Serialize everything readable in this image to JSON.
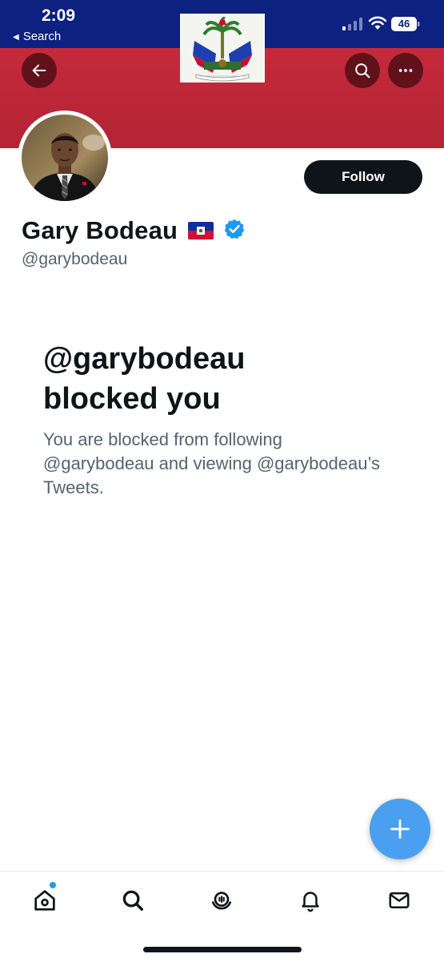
{
  "status_bar": {
    "time": "2:09",
    "back_app": "Search",
    "battery": "46"
  },
  "header": {
    "back_icon": "arrow-left-icon",
    "search_icon": "search-icon",
    "more_icon": "more-horizontal-icon",
    "banner_colors": {
      "top": "#0d2180",
      "bottom": "#c52a3b"
    }
  },
  "profile": {
    "display_name": "Gary Bodeau",
    "handle": "@garybodeau",
    "follow_label": "Follow",
    "flag_emoji": "🇭🇹",
    "verified": true
  },
  "blocked": {
    "title_line1": "@garybodeau",
    "title_line2": "blocked you",
    "description": "You are blocked from following @garybodeau and viewing @garybodeau’s Tweets."
  },
  "fab": {
    "icon": "plus-icon"
  },
  "tabbar": {
    "items": [
      {
        "icon": "home-icon",
        "has_notification_dot": true
      },
      {
        "icon": "search-icon"
      },
      {
        "icon": "spaces-icon"
      },
      {
        "icon": "bell-icon"
      },
      {
        "icon": "mail-icon"
      }
    ]
  },
  "colors": {
    "accent": "#1d9bf0",
    "fab": "#4a9ff0",
    "text_primary": "#0f1419",
    "text_secondary": "#536471"
  }
}
